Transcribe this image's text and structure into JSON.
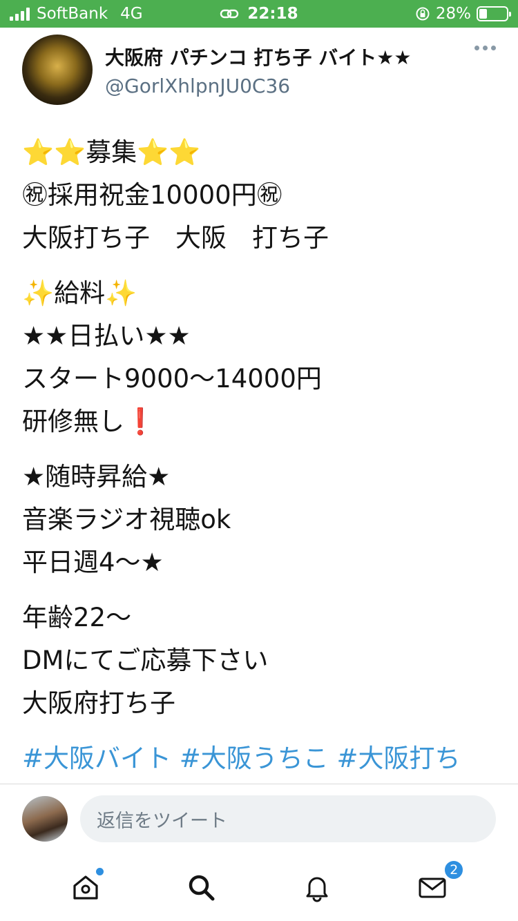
{
  "status_bar": {
    "carrier": "SoftBank",
    "network": "4G",
    "time": "22:18",
    "battery": "28%",
    "battery_level": 0.28
  },
  "tweet": {
    "display_name": "大阪府 パチンコ 打ち子 バイト★★",
    "handle": "@GorlXhlpnJU0C36",
    "paragraphs": [
      [
        "⭐⭐募集⭐⭐",
        "㊗採用祝金10000円㊗",
        "大阪打ち子　大阪　打ち子"
      ],
      [
        "✨給料✨",
        "★★日払い★★",
        "スタート9000～14000円",
        "研修無し❗"
      ],
      [
        "★随時昇給★",
        "音楽ラジオ視聴ok",
        "平日週4～★"
      ],
      [
        "年齢22～",
        "DMにてご応募下さい",
        "大阪府打ち子"
      ]
    ],
    "hashtags": "#大阪バイト #大阪うちこ #大阪打ち"
  },
  "reply": {
    "placeholder": "返信をツイート"
  },
  "tabbar": {
    "home_icon": "home-icon",
    "search_icon": "search-icon",
    "notifications_icon": "bell-icon",
    "messages_icon": "envelope-icon",
    "messages_badge": "2"
  },
  "colors": {
    "status_bar": "#4caf50",
    "link": "#3a95d6",
    "badge": "#2e8fe0"
  }
}
